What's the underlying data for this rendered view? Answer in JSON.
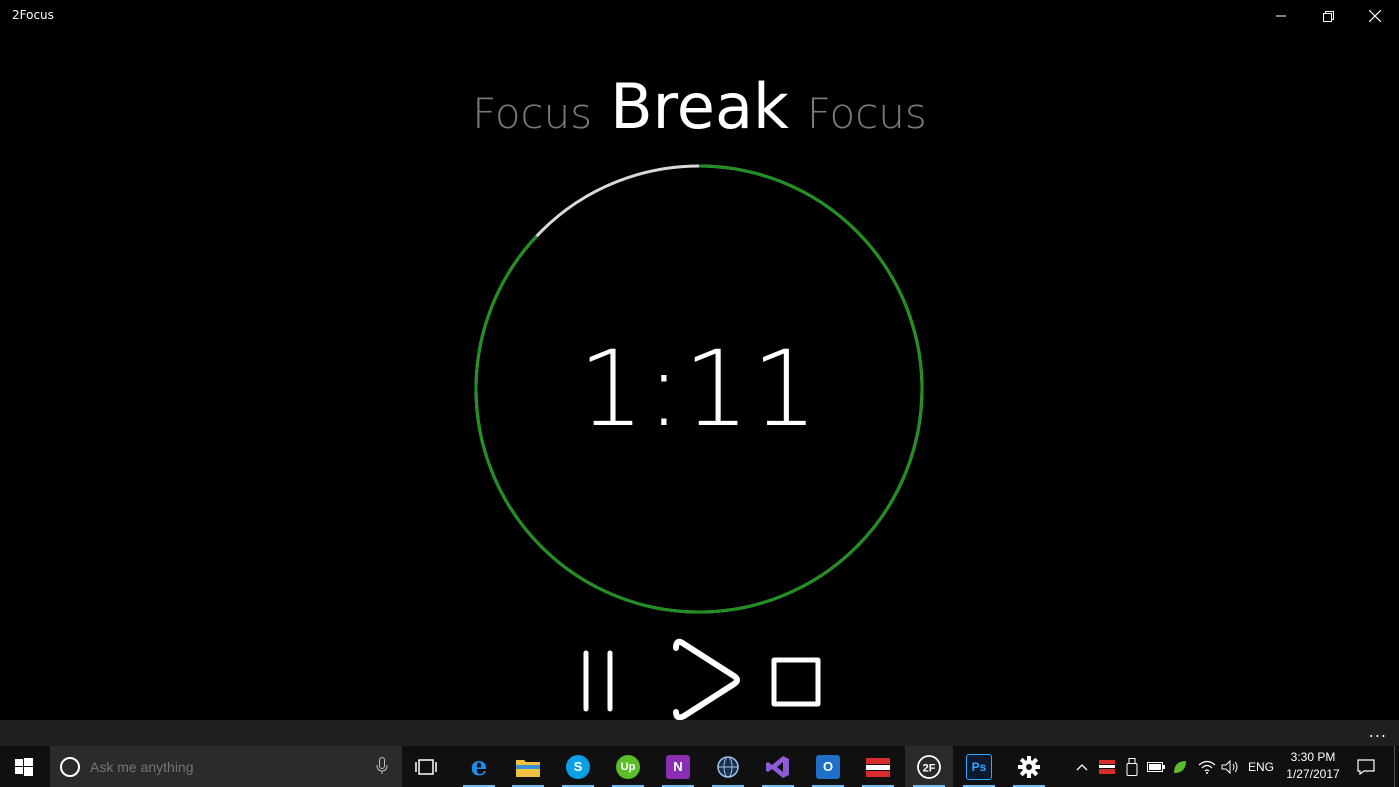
{
  "window": {
    "title": "2Focus"
  },
  "phases": {
    "previous": "Focus",
    "current": "Break",
    "next": "Focus"
  },
  "timer": {
    "display": "1:11",
    "remaining_fraction": 0.87,
    "colors": {
      "remaining": "#1f8f1f",
      "elapsed": "#d9d9d9"
    }
  },
  "controls": {
    "pause": "pause-icon",
    "play": "play-icon",
    "stop": "stop-icon"
  },
  "appbar": {
    "more_label": "..."
  },
  "taskbar": {
    "search_placeholder": "Ask me anything",
    "lang": "ENG",
    "time": "3:30 PM",
    "date": "1/27/2017",
    "apps": [
      "task-view",
      "edge",
      "file-explorer",
      "skype",
      "upwork",
      "onenote",
      "app-globe",
      "visual-studio",
      "outlook",
      "app-red",
      "2focus",
      "photoshop",
      "settings"
    ]
  }
}
